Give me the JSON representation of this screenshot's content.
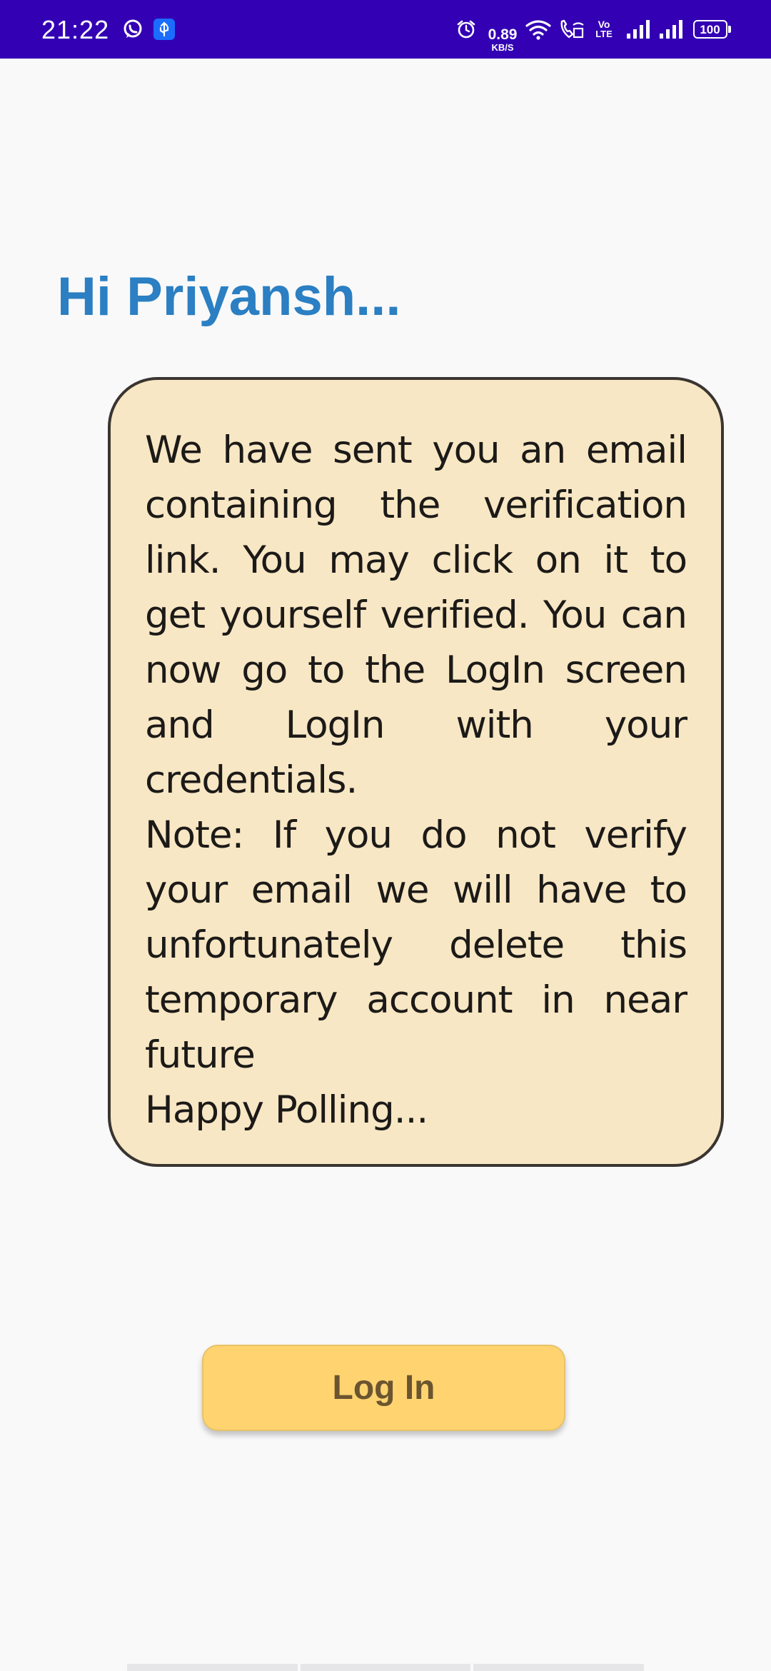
{
  "status_bar": {
    "time": "21:22",
    "left_icons": [
      "whatsapp-icon",
      "usb-icon"
    ],
    "right_icons": [
      "alarm-icon",
      "wifi-icon",
      "wifi-calling-icon",
      "volte-icon",
      "signal-icon",
      "signal-icon",
      "battery-icon"
    ],
    "network_speed_value": "0.89",
    "network_speed_unit": "KB/S",
    "volte_label_top": "Vo",
    "volte_label_bottom": "LTE",
    "battery_level": "100",
    "background_color": "#3300b4"
  },
  "greeting": {
    "text": "Hi Priyansh...",
    "color": "#2b7fc2"
  },
  "message": {
    "paragraphs": [
      "We have sent you an email containing the verification link. You may click on it to get yourself verified. You can now go to the LogIn screen and LogIn with your credentials.",
      "Note: If you do not verify your email we will have to unfortunately delete this temporary account in near future",
      "Happy Polling..."
    ],
    "background_color": "#f8e7c4"
  },
  "login_button": {
    "label": "Log In",
    "background_color": "#ffd470"
  }
}
